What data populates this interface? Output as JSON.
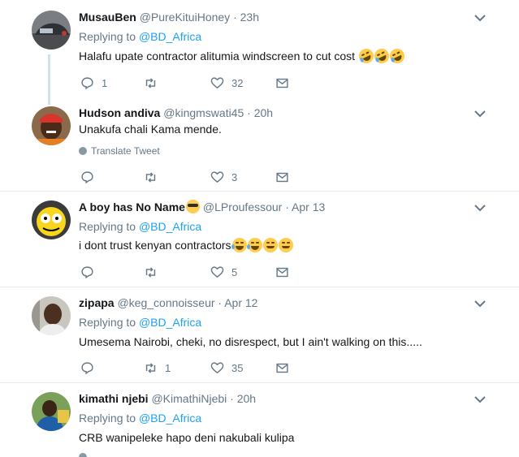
{
  "replying_prefix": "Replying to ",
  "tweets": [
    {
      "name": "MusauBen",
      "handle": "@PureKituiHoney",
      "time": "· 23h",
      "reply_to": "@BD_Africa",
      "text": "Halafu upate contractor alitumia windscreen to cut cost",
      "reply_count": "1",
      "retweet_count": "",
      "like_count": "32"
    },
    {
      "name": "Hudson andiva",
      "handle": "@kingmswati45",
      "time": "· 20h",
      "text": "Unakufa chali Kama mende.",
      "translate": "Translate Tweet",
      "reply_count": "",
      "retweet_count": "",
      "like_count": "3"
    },
    {
      "name": "A boy has No Name",
      "handle": "@LProufessour",
      "time": "· Apr 13",
      "reply_to": "@BD_Africa",
      "text": "i dont trust kenyan contractors",
      "reply_count": "",
      "retweet_count": "",
      "like_count": "5"
    },
    {
      "name": "zipapa",
      "handle": "@keg_connoisseur",
      "time": "· Apr 12",
      "reply_to": "@BD_Africa",
      "text": "Umesema Nairobi, cheki, no disrespect, but I ain't walking on this.....",
      "reply_count": "",
      "retweet_count": "1",
      "like_count": "35"
    },
    {
      "name": "kimathi njebi",
      "handle": "@KimathiNjebi",
      "time": "· 20h",
      "reply_to": "@BD_Africa",
      "text": "CRB wanipeleke hapo deni nakubali kulipa"
    }
  ],
  "colors": {
    "link": "#1da1f2",
    "muted": "#657786",
    "text": "#14171a",
    "divider": "#e6ecf0",
    "thread_line": "#cfe0ee"
  },
  "icons": [
    "reply-icon",
    "retweet-icon",
    "like-icon",
    "message-icon",
    "chevron-down-icon",
    "globe-icon"
  ]
}
